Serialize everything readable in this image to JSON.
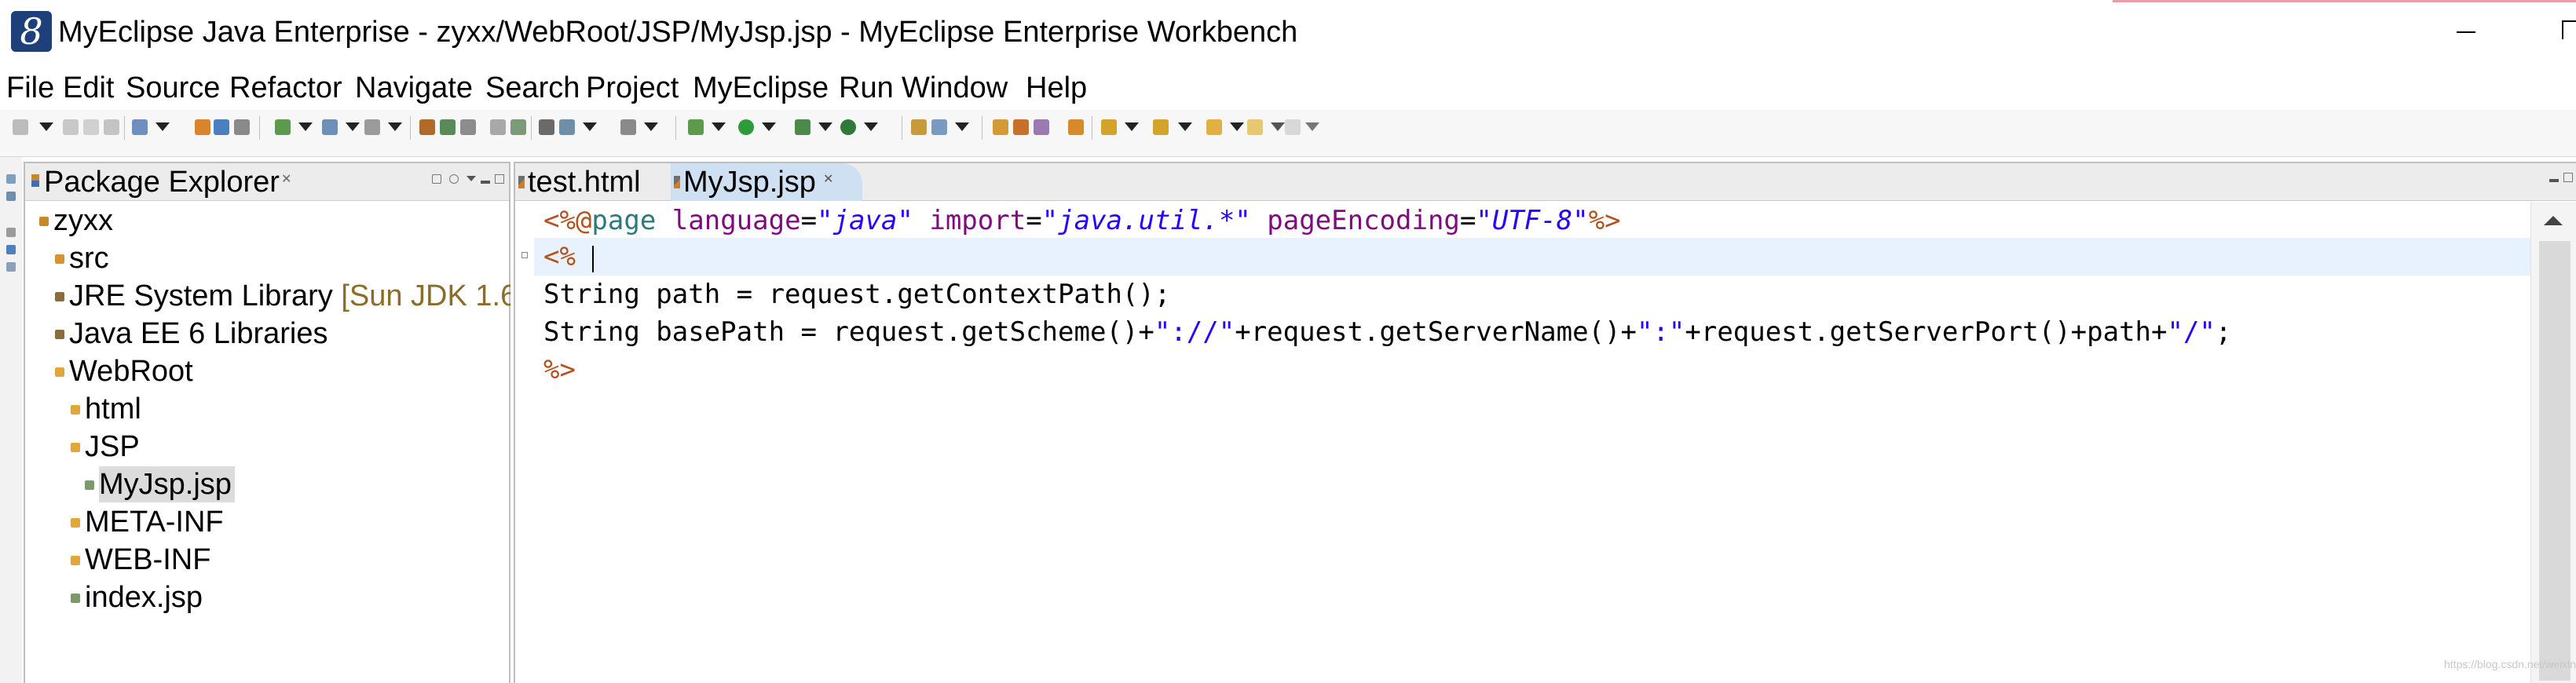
{
  "window": {
    "title": "MyEclipse Java Enterprise - zyxx/WebRoot/JSP/MyJsp.jsp - MyEclipse Enterprise Workbench",
    "logo_glyph": "8"
  },
  "menu": [
    "File",
    "Edit",
    "Source",
    "Refactor",
    "Navigate",
    "Search",
    "Project",
    "MyEclipse",
    "Run",
    "Window",
    "Help"
  ],
  "package_explorer": {
    "title": "Package Explorer",
    "close_glyph": "✕",
    "tree": [
      {
        "label": "zyxx",
        "decoration": "",
        "icon": "project-icon"
      },
      {
        "label": "src",
        "decoration": "",
        "icon": "source-folder-icon"
      },
      {
        "label": "JRE System Library ",
        "decoration": "[Sun JDK 1.6",
        "icon": "library-icon"
      },
      {
        "label": "Java EE 6 Libraries",
        "decoration": "",
        "icon": "library-icon"
      },
      {
        "label": "WebRoot",
        "decoration": "",
        "icon": "folder-icon"
      },
      {
        "label": "html",
        "decoration": "",
        "icon": "folder-icon"
      },
      {
        "label": "JSP",
        "decoration": "",
        "icon": "folder-icon"
      },
      {
        "label": "MyJsp.jsp",
        "decoration": "",
        "icon": "jsp-file-icon"
      },
      {
        "label": "META-INF",
        "decoration": "",
        "icon": "folder-icon"
      },
      {
        "label": "WEB-INF",
        "decoration": "",
        "icon": "folder-icon"
      },
      {
        "label": "index.jsp",
        "decoration": "",
        "icon": "jsp-file-icon"
      }
    ]
  },
  "editor": {
    "tabs": [
      {
        "label": "test.html",
        "active": false
      },
      {
        "label": "MyJsp.jsp",
        "active": true,
        "close_glyph": "✕"
      }
    ],
    "code": {
      "line1": {
        "delim_open": "<%@",
        "directive": "page",
        "sp1": " ",
        "attr1": "language",
        "eq1": "=",
        "val1": "\"java\"",
        "sp2": " ",
        "attr2": "import",
        "eq2": "=",
        "val2": "\"java.util.*\"",
        "sp3": " ",
        "attr3": "pageEncoding",
        "eq3": "=",
        "val3": "\"UTF-8\"",
        "delim_close": "%>"
      },
      "line2": "<%",
      "line3": "String path = request.getContextPath();",
      "line4": {
        "p1": "String basePath = request.getScheme()+",
        "s1": "\"://\"",
        "p2": "+request.getServerName()+",
        "s2": "\":\"",
        "p3": "+request.getServerPort()+path+",
        "s3": "\"/\"",
        "p4": ";"
      },
      "line5": "%>"
    }
  },
  "watermark": "https://blog.csdn.net/weixin_46587872",
  "colors": {
    "jsp_delimiter": "#b4521f",
    "directive": "#2c7a7a",
    "attribute": "#7f0b7f",
    "string": "#2a00ff",
    "current_line": "#e8f2fe",
    "active_tab": "#cfe0f3"
  }
}
